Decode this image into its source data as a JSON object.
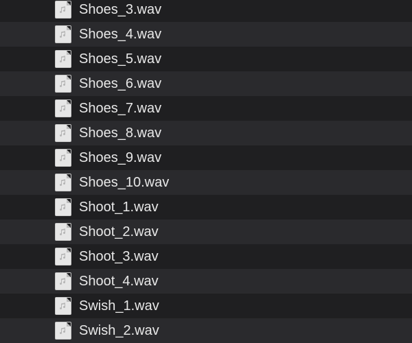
{
  "files": [
    {
      "name": "Shoes_3.wav",
      "icon": "audio-file-icon"
    },
    {
      "name": "Shoes_4.wav",
      "icon": "audio-file-icon"
    },
    {
      "name": "Shoes_5.wav",
      "icon": "audio-file-icon"
    },
    {
      "name": "Shoes_6.wav",
      "icon": "audio-file-icon"
    },
    {
      "name": "Shoes_7.wav",
      "icon": "audio-file-icon"
    },
    {
      "name": "Shoes_8.wav",
      "icon": "audio-file-icon"
    },
    {
      "name": "Shoes_9.wav",
      "icon": "audio-file-icon"
    },
    {
      "name": "Shoes_10.wav",
      "icon": "audio-file-icon"
    },
    {
      "name": "Shoot_1.wav",
      "icon": "audio-file-icon"
    },
    {
      "name": "Shoot_2.wav",
      "icon": "audio-file-icon"
    },
    {
      "name": "Shoot_3.wav",
      "icon": "audio-file-icon"
    },
    {
      "name": "Shoot_4.wav",
      "icon": "audio-file-icon"
    },
    {
      "name": "Swish_1.wav",
      "icon": "audio-file-icon"
    },
    {
      "name": "Swish_2.wav",
      "icon": "audio-file-icon"
    }
  ],
  "colors": {
    "row_even": "#1f1f21",
    "row_odd": "#2a2a2d",
    "text": "#e8e8e8"
  }
}
